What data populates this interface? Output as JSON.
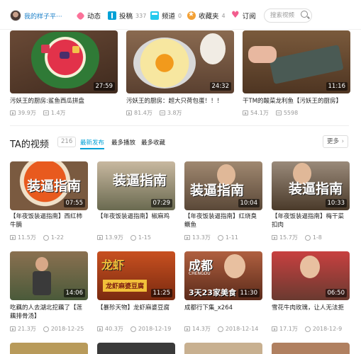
{
  "nav": {
    "username": "我的样子平···",
    "items": [
      {
        "label": "动态",
        "count": ""
      },
      {
        "label": "投稿",
        "count": "337"
      },
      {
        "label": "频道",
        "count": "0"
      },
      {
        "label": "收藏夹",
        "count": "4"
      },
      {
        "label": "订阅",
        "count": ""
      }
    ],
    "search_placeholder": "搜索视频"
  },
  "top_videos": [
    {
      "title": "污妖王的厨房:鲨鱼西瓜拼盘",
      "duration": "27:59",
      "plays": "39.9万",
      "danmaku": "1.4万"
    },
    {
      "title": "污妖王的厨房：超大只荷包蛋！！！",
      "duration": "24:32",
      "plays": "81.4万",
      "danmaku": "3.8万"
    },
    {
      "title": "干TM的酸菜龙利鱼【污妖王的厨房】",
      "duration": "11:16",
      "plays": "54.1万",
      "danmaku": "5598"
    }
  ],
  "section": {
    "title": "TA的视频",
    "count": "216",
    "tabs": [
      "最新发布",
      "最多播放",
      "最多收藏"
    ],
    "more": "更多"
  },
  "videos": [
    {
      "title": "【年夜饭装逼指南】西红柿牛腩",
      "duration": "07:55",
      "plays": "11.5万",
      "date": "1-22",
      "caption": "装逼指南"
    },
    {
      "title": "【年夜饭装逼指南】椒麻鸡",
      "duration": "07:29",
      "plays": "13.9万",
      "date": "1-15",
      "caption": "装逼指南"
    },
    {
      "title": "【年夜饭装逼指南】红烧臭鳜鱼",
      "duration": "10:04",
      "plays": "13.3万",
      "date": "1-11",
      "caption": "装逼指南"
    },
    {
      "title": "【年夜饭装逼指南】梅干菜扣肉",
      "duration": "10:33",
      "plays": "15.7万",
      "date": "1-8",
      "caption": "装逼指南"
    },
    {
      "title": "吃藕的人去湖北挖藕了【莲藕排骨汤】",
      "duration": "14:06",
      "plays": "21.3万",
      "date": "2018-12-25",
      "caption": ""
    },
    {
      "title": "【暴殄天物】龙虾麻婆豆腐",
      "duration": "11:25",
      "plays": "40.3万",
      "date": "2018-12-19",
      "caption": "龙虾"
    },
    {
      "title": "成都行下集_x264",
      "duration": "11:30",
      "plays": "14.3万",
      "date": "2018-12-14",
      "caption": "成都"
    },
    {
      "title": "雪花牛肉玫瑰，让人无法拒绝",
      "duration": "06:50",
      "plays": "17.1万",
      "date": "2018-12-9",
      "caption": ""
    }
  ],
  "thumb_overlays": {
    "chengdu_sub": "CHENGDU",
    "chengdu_banner": "3天23家美食",
    "lobster_banner": "龙虾麻婆豆腐"
  },
  "colors": {
    "accent": "#00a1d6",
    "pink": "#fb7299"
  }
}
